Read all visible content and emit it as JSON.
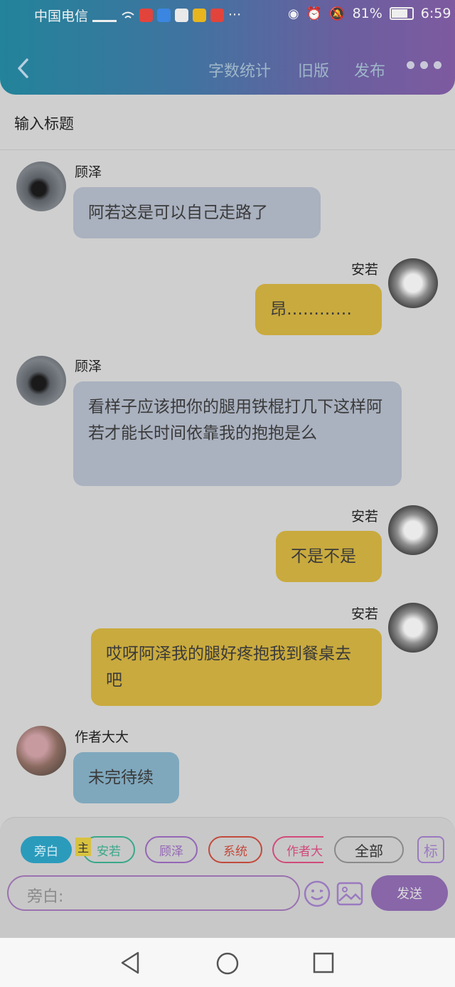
{
  "status_bar": {
    "carrier": "中国电信",
    "battery": "81%",
    "time": "6:59"
  },
  "header": {
    "word_count": "字数统计",
    "old_version": "旧版",
    "publish": "发布"
  },
  "title_placeholder": "输入标题",
  "messages": [
    {
      "side": "left",
      "name": "顾泽",
      "text": "阿若这是可以自己走路了"
    },
    {
      "side": "right",
      "name": "安若",
      "text": "昂…………"
    },
    {
      "side": "left",
      "name": "顾泽",
      "text": "看样子应该把你的腿用铁棍打几下这样阿若才能长时间依靠我的抱抱是么"
    },
    {
      "side": "right",
      "name": "安若",
      "text": "不是不是"
    },
    {
      "side": "right",
      "name": "安若",
      "text": "哎呀阿泽我的腿好疼抱我到餐桌去吧"
    },
    {
      "side": "left",
      "name": "作者大大",
      "text": "未完待续"
    }
  ],
  "composer": {
    "chips": [
      "旁白",
      "安若",
      "顾泽",
      "系统",
      "作者大",
      "全部"
    ],
    "main_badge": "主",
    "tag_button": "标",
    "input_placeholder": "旁白:",
    "send_label": "发送"
  },
  "colors": {
    "header_gradient_start": "#22839a",
    "header_gradient_end": "#7e5aa0",
    "left_bubble": "#aab1bf",
    "right_bubble": "#c9aa3e",
    "author_bubble": "#7fa8bd",
    "send_button": "#8866a8"
  }
}
